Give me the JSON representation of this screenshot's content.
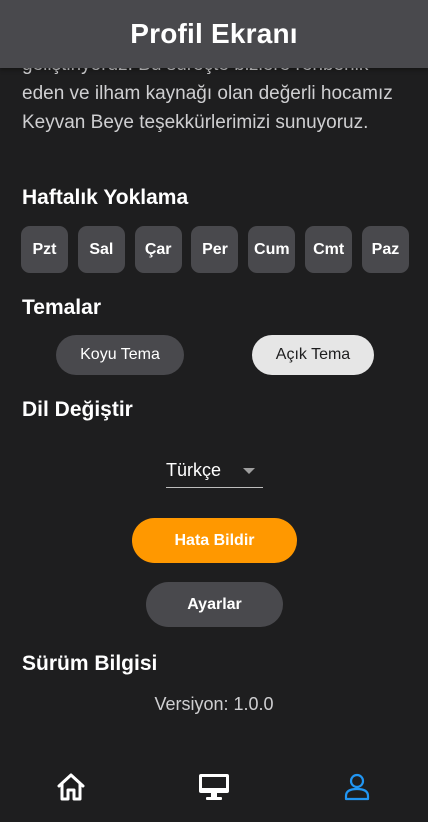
{
  "header": {
    "title": "Profil Ekranı"
  },
  "about": {
    "text": "geliştiriyoruz. Bu süreçte bizlere rehberlik eden ve ilham kaynağı olan değerli hocamız Keyvan Beye teşekkürlerimizi sunuyoruz."
  },
  "attendance": {
    "title": "Haftalık Yoklama",
    "days": [
      "Pzt",
      "Sal",
      "Çar",
      "Per",
      "Cum",
      "Cmt",
      "Paz"
    ]
  },
  "themes": {
    "title": "Temalar",
    "dark_label": "Koyu Tema",
    "light_label": "Açık Tema"
  },
  "language": {
    "title": "Dil Değiştir",
    "selected": "Türkçe"
  },
  "actions": {
    "report_label": "Hata Bildir",
    "settings_label": "Ayarlar"
  },
  "version_info": {
    "title": "Sürüm Bilgisi",
    "text": "Versiyon: 1.0.0"
  },
  "bottom_nav": {
    "items": [
      {
        "icon": "home-icon",
        "active": false
      },
      {
        "icon": "monitor-icon",
        "active": false
      },
      {
        "icon": "person-icon",
        "active": true
      }
    ]
  },
  "colors": {
    "background": "#1e1e1f",
    "app_bar": "#49494d",
    "button_dark": "#49494d",
    "button_light": "#e6e6e6",
    "accent_orange": "#ff9800",
    "active_nav": "#2196f3"
  }
}
